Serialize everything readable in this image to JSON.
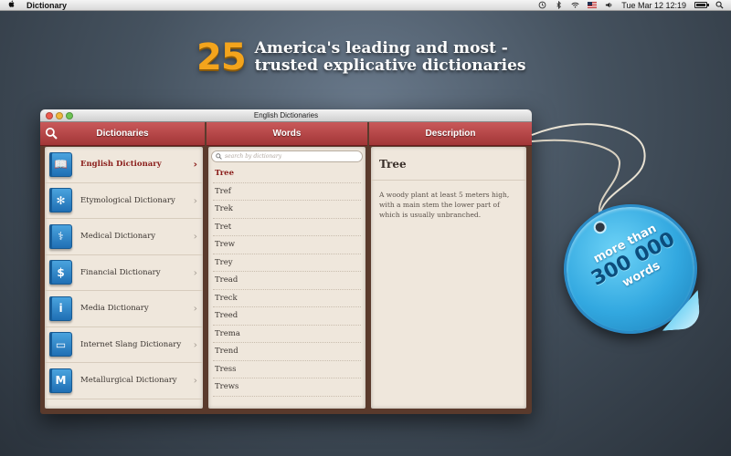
{
  "menubar": {
    "app_name": "Dictionary",
    "clock": "Tue Mar 12  12:19"
  },
  "headline": {
    "number": "25",
    "line1": "America's leading and most -",
    "line2": "trusted explicative dictionaries"
  },
  "window": {
    "title": "English Dictionaries"
  },
  "columns": {
    "dictionaries": "Dictionaries",
    "words": "Words",
    "description": "Description"
  },
  "dictionaries": [
    {
      "label": "English Dictionary",
      "icon": "book-icon",
      "glyph": "📖",
      "active": true
    },
    {
      "label": "Etymological Dictionary",
      "icon": "tree-icon",
      "glyph": "✻",
      "active": false
    },
    {
      "label": "Medical Dictionary",
      "icon": "caduceus-icon",
      "glyph": "⚕",
      "active": false
    },
    {
      "label": "Financial Dictionary",
      "icon": "moneybag-icon",
      "glyph": "$",
      "active": false
    },
    {
      "label": "Media Dictionary",
      "icon": "info-icon",
      "glyph": "i",
      "active": false
    },
    {
      "label": "Internet Slang Dictionary",
      "icon": "monitor-icon",
      "glyph": "▭",
      "active": false
    },
    {
      "label": "Metallurgical Dictionary",
      "icon": "metal-m-icon",
      "glyph": "M",
      "active": false
    }
  ],
  "search": {
    "placeholder": "search by dictionary"
  },
  "words": [
    "Tree",
    "Tref",
    "Trek",
    "Tret",
    "Trew",
    "Trey",
    "Tread",
    "Treck",
    "Treed",
    "Trema",
    "Trend",
    "Tress",
    "Trews"
  ],
  "selected_word": "Tree",
  "description": {
    "title": "Tree",
    "body": "A woody plant at least 5 meters high, with a main stem the lower part of which is usually unbranched."
  },
  "tag": {
    "line1": "more than",
    "line2": "300 000",
    "line3": "words"
  },
  "colors": {
    "header_red": "#b14243",
    "accent_orange": "#f3a41c",
    "tag_blue": "#32a8e0",
    "active_text": "#8a1d1a"
  }
}
